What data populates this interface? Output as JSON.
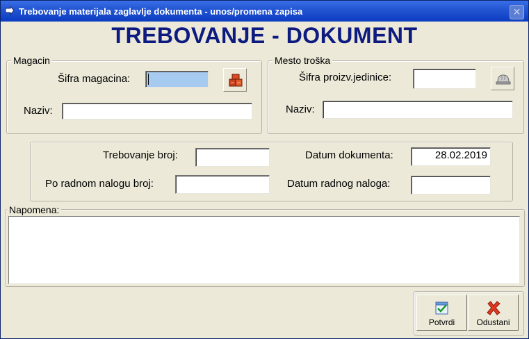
{
  "window": {
    "title": "Trebovanje materijala zaglavlje dokumenta - unos/promena zapisa",
    "close_glyph": "✕"
  },
  "header": {
    "title": "TREBOVANJE - DOKUMENT"
  },
  "magacin": {
    "legend": "Magacin",
    "sifra_label": "Šifra magacina:",
    "sifra_value": "",
    "naziv_label": "Naziv:",
    "naziv_value": "",
    "lookup_icon": "warehouse-boxes-icon"
  },
  "mesto_troska": {
    "legend": "Mesto troška",
    "sifra_label": "Šifra proizv.jedinice:",
    "sifra_value": "",
    "naziv_label": "Naziv:",
    "naziv_value": "",
    "lookup_icon": "hard-hat-icon"
  },
  "document": {
    "trebovanje_label": "Trebovanje broj:",
    "trebovanje_value": "",
    "datum_dokumenta_label": "Datum dokumenta:",
    "datum_dokumenta_value": "28.02.2019",
    "radni_nalog_label": "Po radnom nalogu broj:",
    "radni_nalog_value": "",
    "datum_naloga_label": "Datum radnog naloga:",
    "datum_naloga_value": ""
  },
  "napomena": {
    "legend": "Napomena:",
    "value": ""
  },
  "buttons": {
    "confirm": "Potvrdi",
    "cancel": "Odustani"
  },
  "colors": {
    "title_text": "#0d1a80",
    "focused_field": "#a6caf0",
    "titlebar": "#0b3cc2"
  }
}
